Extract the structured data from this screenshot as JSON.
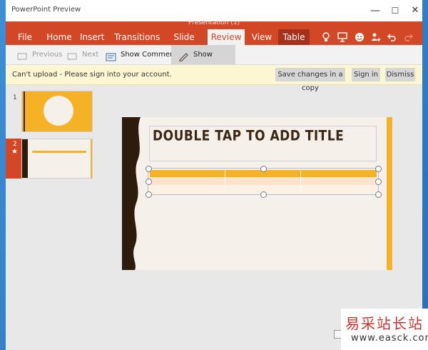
{
  "window": {
    "app_title": "PowerPoint Preview",
    "controls": {
      "minimize": "—",
      "maximize": "☐",
      "close": "✕"
    }
  },
  "ribbon": {
    "doc_title": "Presentation (1)",
    "tabs": [
      {
        "label": "File"
      },
      {
        "label": "Home"
      },
      {
        "label": "Insert"
      },
      {
        "label": "Transitions"
      },
      {
        "label": "Slide Show"
      },
      {
        "label": "Review",
        "active": true
      },
      {
        "label": "View"
      },
      {
        "label": "Table",
        "contextual": true
      }
    ],
    "icons": [
      "lightbulb-icon",
      "present-icon",
      "smiley-icon",
      "share-icon",
      "undo-icon",
      "redo-icon"
    ],
    "accent": "#d24726"
  },
  "toolbar": {
    "previous_label": "Previous",
    "next_label": "Next",
    "show_comments_label": "Show Comments",
    "show_markup_label": "Show Markup"
  },
  "infobar": {
    "message": "Can't upload - Please sign into your account.",
    "save_copy_label": "Save changes in a copy",
    "signin_label": "Sign in",
    "dismiss_label": "Dismiss"
  },
  "thumbnails": [
    {
      "number": "1"
    },
    {
      "number": "2",
      "badge": "★",
      "selected": true
    }
  ],
  "slide": {
    "title_placeholder": "DOUBLE TAP TO ADD TITLE",
    "colors": {
      "accent": "#f6b227",
      "dark": "#2d1c0c",
      "background": "#f5f1ea"
    }
  },
  "watermark": {
    "text_cn": "易采站长站",
    "url": "www.easck.com"
  }
}
